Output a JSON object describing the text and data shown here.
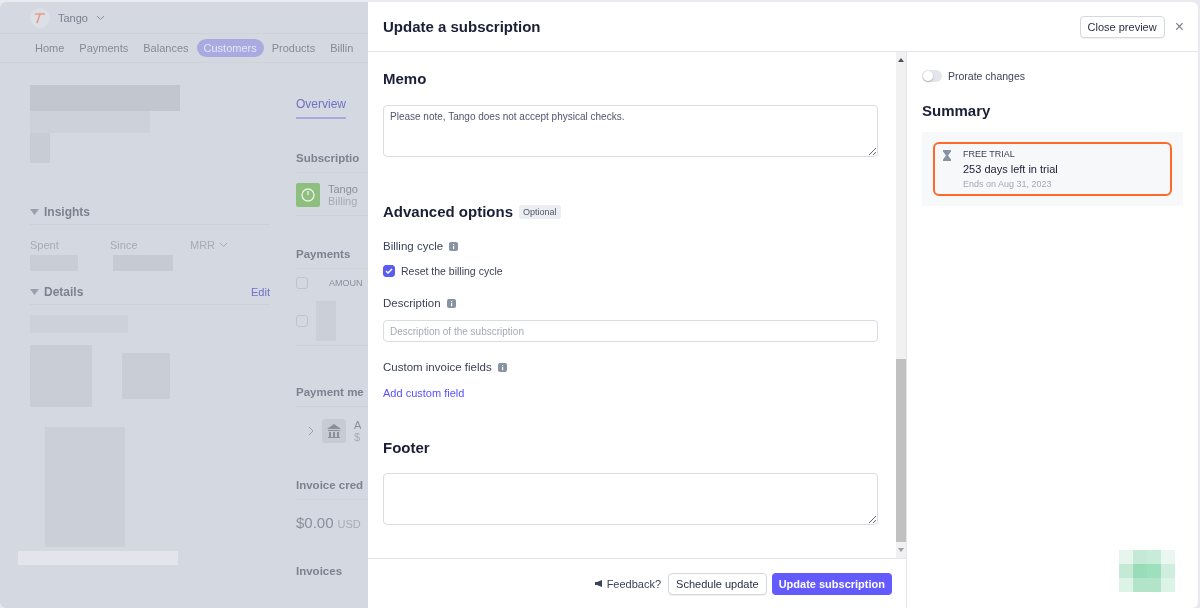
{
  "background_page": {
    "account": "Tango",
    "nav": [
      {
        "label": "Home",
        "selected": false
      },
      {
        "label": "Payments",
        "selected": false
      },
      {
        "label": "Balances",
        "selected": false
      },
      {
        "label": "Customers",
        "selected": true
      },
      {
        "label": "Products",
        "selected": false
      },
      {
        "label": "Billin",
        "selected": false
      }
    ],
    "insights": {
      "title": "Insights",
      "stats": [
        "Spent",
        "Since",
        "MRR"
      ]
    },
    "details": {
      "title": "Details",
      "action": "Edit"
    },
    "overview_tab": "Overview",
    "subscriptions_heading": "Subscriptio",
    "subscription_item": {
      "name": "Tango",
      "detail": "Billing"
    },
    "payments_heading": "Payments",
    "payments_column": "AMOUN",
    "payment_rows": [
      {
        "checked": false
      },
      {
        "checked": false
      }
    ],
    "payment_method_heading": "Payment me",
    "payment_method": {
      "line_1": "A",
      "line_2": "$"
    },
    "invoice_credit_heading": "Invoice cred",
    "invoice_credit": {
      "amount": "$0.00",
      "currency": "USD"
    },
    "invoices_heading": "Invoices"
  },
  "modal": {
    "title": "Update a subscription",
    "close_preview": "Close preview",
    "close": "×",
    "memo": {
      "heading": "Memo",
      "value": "Please note, Tango does not accept physical checks."
    },
    "advanced": {
      "heading": "Advanced options",
      "badge": "Optional",
      "billing_cycle": {
        "label": "Billing cycle",
        "option": {
          "label": "Reset the billing cycle",
          "checked": true
        }
      },
      "description": {
        "label": "Description",
        "placeholder": "Description of the subscription"
      },
      "custom_fields": {
        "label": "Custom invoice fields",
        "link": "Add custom field"
      }
    },
    "footer_section": {
      "heading": "Footer"
    },
    "actions": {
      "feedback": "Feedback?",
      "secondary": "Schedule update",
      "primary": "Update subscription"
    },
    "preview": {
      "prorate": {
        "label": "Prorate changes",
        "on": false
      },
      "summary": {
        "heading": "Summary",
        "trial": {
          "kind": "trial",
          "tag": "FREE TRIAL",
          "title": "253 days left in trial",
          "ends": "Ends on Aug 31, 2023"
        }
      }
    }
  }
}
